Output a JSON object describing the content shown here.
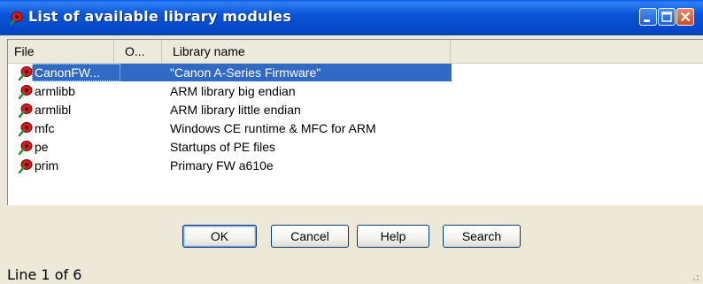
{
  "window": {
    "title": "List of available library modules",
    "title_icon": "ida-bug-icon"
  },
  "columns": {
    "file": "File",
    "o": "O...",
    "library": "Library name"
  },
  "rows": [
    {
      "file": "CanonFW...",
      "library": "\"Canon A-Series Firmware\"",
      "selected": true,
      "icon": "ida-bug-icon"
    },
    {
      "file": "armlibb",
      "library": "ARM library big endian",
      "selected": false,
      "icon": "ida-bug-icon"
    },
    {
      "file": "armlibl",
      "library": "ARM library little endian",
      "selected": false,
      "icon": "ida-bug-icon"
    },
    {
      "file": "mfc",
      "library": "Windows CE runtime & MFC for ARM",
      "selected": false,
      "icon": "ida-bug-icon"
    },
    {
      "file": "pe",
      "library": "Startups of PE files",
      "selected": false,
      "icon": "ida-bug-icon"
    },
    {
      "file": "prim",
      "library": "Primary FW a610e",
      "selected": false,
      "icon": "ida-bug-icon"
    }
  ],
  "buttons": {
    "ok": "OK",
    "cancel": "Cancel",
    "help": "Help",
    "search": "Search"
  },
  "status": "Line 1 of 6",
  "colors": {
    "titlebar": "#0a55d8",
    "selection": "#316ac5",
    "dialog_bg": "#ece9d8"
  }
}
